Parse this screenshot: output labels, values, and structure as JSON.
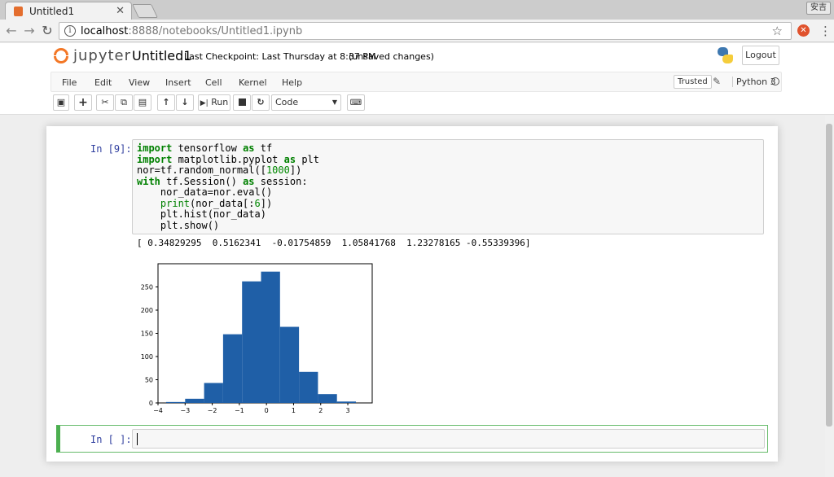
{
  "browser": {
    "tab_title": "Untitled1",
    "profile_label": "安吉",
    "url_host": "localhost",
    "url_rest": ":8888/notebooks/Untitled1.ipynb"
  },
  "header": {
    "logo_text": "jupyter",
    "notebook_name": "Untitled1",
    "checkpoint": "Last Checkpoint: Last Thursday at 8:37 PM",
    "autosave": "(unsaved changes)",
    "logout_label": "Logout"
  },
  "menubar": {
    "items": [
      "File",
      "Edit",
      "View",
      "Insert",
      "Cell",
      "Kernel",
      "Help"
    ],
    "trusted_label": "Trusted",
    "kernel_name": "Python 3"
  },
  "toolbar": {
    "run_label": "Run",
    "cell_type": "Code"
  },
  "cells": [
    {
      "prompt": "In [9]:",
      "output": "[ 0.34829295  0.5162341  -0.01754859  1.05841768  1.23278165 -0.55339396]"
    },
    {
      "prompt": "In [ ]:"
    }
  ],
  "chart_data": {
    "type": "bar",
    "x_edges": [
      -3.7,
      -3.0,
      -2.3,
      -1.6,
      -0.9,
      -0.2,
      0.5,
      1.2,
      1.9,
      2.6,
      3.3
    ],
    "values": [
      2,
      9,
      43,
      148,
      262,
      283,
      164,
      67,
      19,
      3
    ],
    "xticks": [
      -4,
      -3,
      -2,
      -1,
      0,
      1,
      2,
      3
    ],
    "yticks": [
      0,
      50,
      100,
      150,
      200,
      250
    ],
    "xlim": [
      -4.0,
      3.9
    ],
    "ylim": [
      0,
      300
    ],
    "bar_color": "#1f5fa7"
  }
}
